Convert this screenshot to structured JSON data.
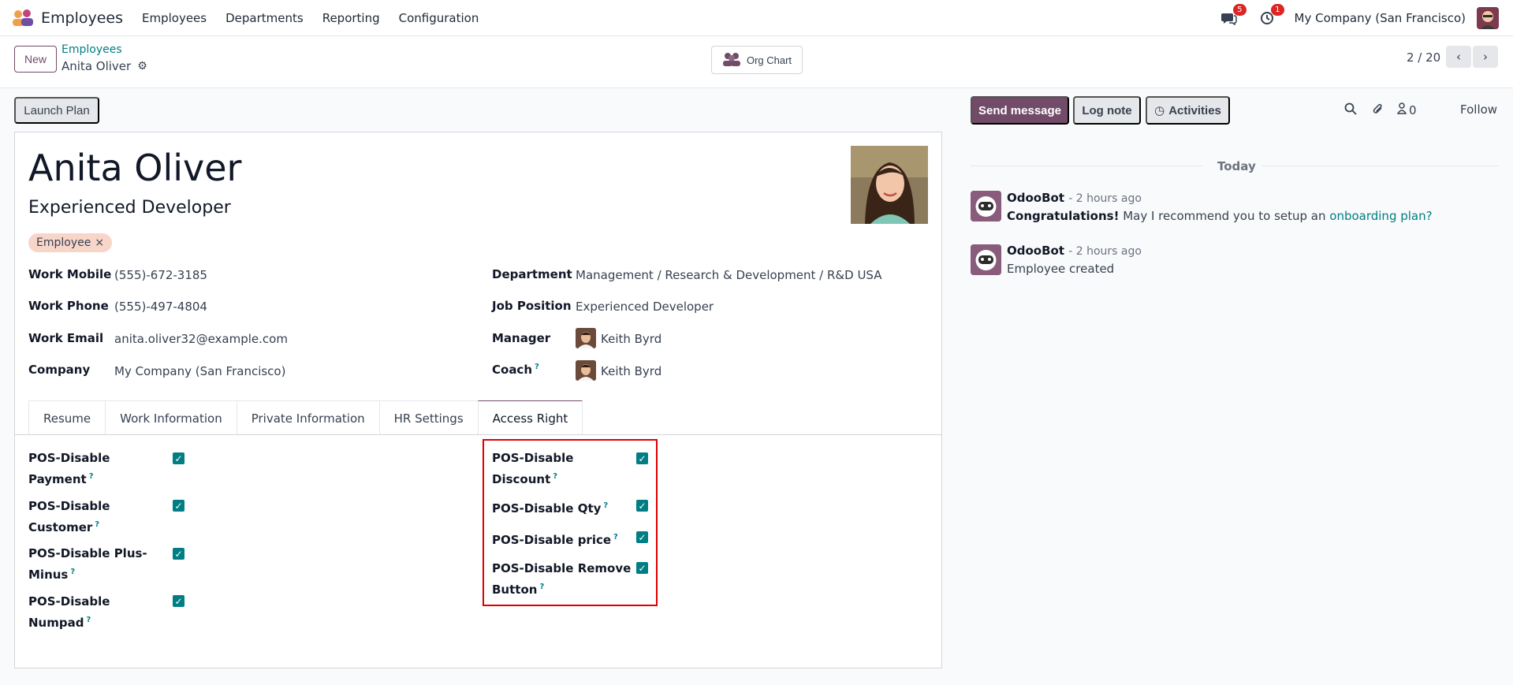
{
  "navbar": {
    "app_name": "Employees",
    "menu": [
      "Employees",
      "Departments",
      "Reporting",
      "Configuration"
    ],
    "messages_count": "5",
    "activities_count": "1",
    "company": "My Company (San Francisco)"
  },
  "control": {
    "new_label": "New",
    "breadcrumb": "Employees",
    "record_name": "Anita Oliver",
    "org_chart_label": "Org Chart",
    "pager": "2 / 20"
  },
  "form": {
    "launch_plan": "Launch Plan",
    "name": "Anita Oliver",
    "job_title": "Experienced Developer",
    "tag": "Employee",
    "fields_left": [
      {
        "label": "Work Mobile",
        "value": "(555)-672-3185"
      },
      {
        "label": "Work Phone",
        "value": "(555)-497-4804"
      },
      {
        "label": "Work Email",
        "value": "anita.oliver32@example.com"
      },
      {
        "label": "Company",
        "value": "My Company (San Francisco)"
      }
    ],
    "fields_right": [
      {
        "label": "Department",
        "value": "Management / Research & Development / R&D USA"
      },
      {
        "label": "Job Position",
        "value": "Experienced Developer"
      },
      {
        "label": "Manager",
        "value": "Keith Byrd"
      },
      {
        "label": "Coach",
        "value": "Keith Byrd"
      }
    ],
    "tabs": [
      "Resume",
      "Work Information",
      "Private Information",
      "HR Settings",
      "Access Right"
    ],
    "active_tab": "Access Right",
    "access_left": [
      {
        "line1": "POS-Disable",
        "line2": "Payment",
        "checked": true
      },
      {
        "line1": "POS-Disable",
        "line2": "Customer",
        "checked": true
      },
      {
        "line1": "POS-Disable Plus-",
        "line2": "Minus",
        "checked": true
      },
      {
        "line1": "POS-Disable",
        "line2": "Numpad",
        "checked": true
      }
    ],
    "access_right": [
      {
        "line1": "POS-Disable",
        "line2": "Discount",
        "checked": true
      },
      {
        "line1": "POS-Disable Qty",
        "line2": "",
        "checked": true
      },
      {
        "line1": "POS-Disable price",
        "line2": "",
        "checked": true
      },
      {
        "line1": "POS-Disable Remove",
        "line2": "Button",
        "checked": true
      }
    ]
  },
  "chatter": {
    "send_message": "Send message",
    "log_note": "Log note",
    "activities": "Activities",
    "followers_count": "0",
    "follow": "Follow",
    "date_separator": "Today",
    "messages": [
      {
        "author": "OdooBot",
        "time": "- 2 hours ago",
        "bold": "Congratulations!",
        "text": " May I recommend you to setup an ",
        "link": "onboarding plan?"
      },
      {
        "author": "OdooBot",
        "time": "- 2 hours ago",
        "bold": "",
        "text": "Employee created",
        "link": ""
      }
    ]
  },
  "colors": {
    "primary": "#714b67",
    "accent": "#017e84",
    "highlight": "#e00000",
    "tag_bg": "#f8d5c9"
  }
}
